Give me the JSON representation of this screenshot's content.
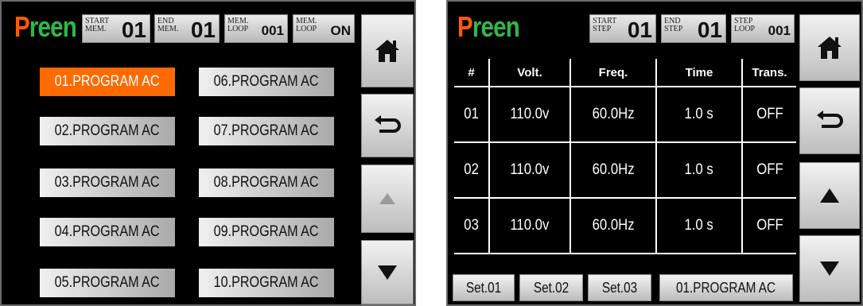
{
  "screen1": {
    "logo": {
      "first": "P",
      "rest": "reen"
    },
    "header": [
      {
        "label": "START\nMEM.",
        "value": "01"
      },
      {
        "label": "END\nMEM.",
        "value": "01"
      },
      {
        "label": "MEM.\nLOOP",
        "value": "001"
      },
      {
        "label": "MEM.\nLOOP",
        "value": "ON"
      }
    ],
    "programs": [
      "01.PROGRAM AC",
      "02.PROGRAM AC",
      "03.PROGRAM AC",
      "04.PROGRAM AC",
      "05.PROGRAM AC",
      "06.PROGRAM AC",
      "07.PROGRAM AC",
      "08.PROGRAM AC",
      "09.PROGRAM AC",
      "10.PROGRAM AC"
    ],
    "selected_program": "01.PROGRAM AC"
  },
  "screen2": {
    "logo": {
      "first": "P",
      "rest": "reen"
    },
    "header": [
      {
        "label": "START\nSTEP",
        "value": "01"
      },
      {
        "label": "END\nSTEP",
        "value": "01"
      },
      {
        "label": "STEP\nLOOP",
        "value": "001"
      }
    ],
    "columns": [
      "#",
      "Volt.",
      "Freq.",
      "Time",
      "Trans."
    ],
    "rows": [
      [
        "01",
        "110.0v",
        "60.0Hz",
        "1.0 s",
        "OFF"
      ],
      [
        "02",
        "110.0v",
        "60.0Hz",
        "1.0 s",
        "OFF"
      ],
      [
        "03",
        "110.0v",
        "60.0Hz",
        "1.0 s",
        "OFF"
      ]
    ],
    "set_buttons": [
      "Set.01",
      "Set.02",
      "Set.03"
    ],
    "program_name": "01.PROGRAM AC"
  },
  "icons": {
    "home": "home-icon",
    "back": "back-arrow-icon",
    "up": "up-triangle-icon",
    "down": "down-triangle-icon"
  },
  "colors": {
    "accent": "#ff6a00",
    "logo_p": "#ff5a00",
    "logo_rest": "#2fb84a",
    "disabled": "#9b9b9b"
  }
}
